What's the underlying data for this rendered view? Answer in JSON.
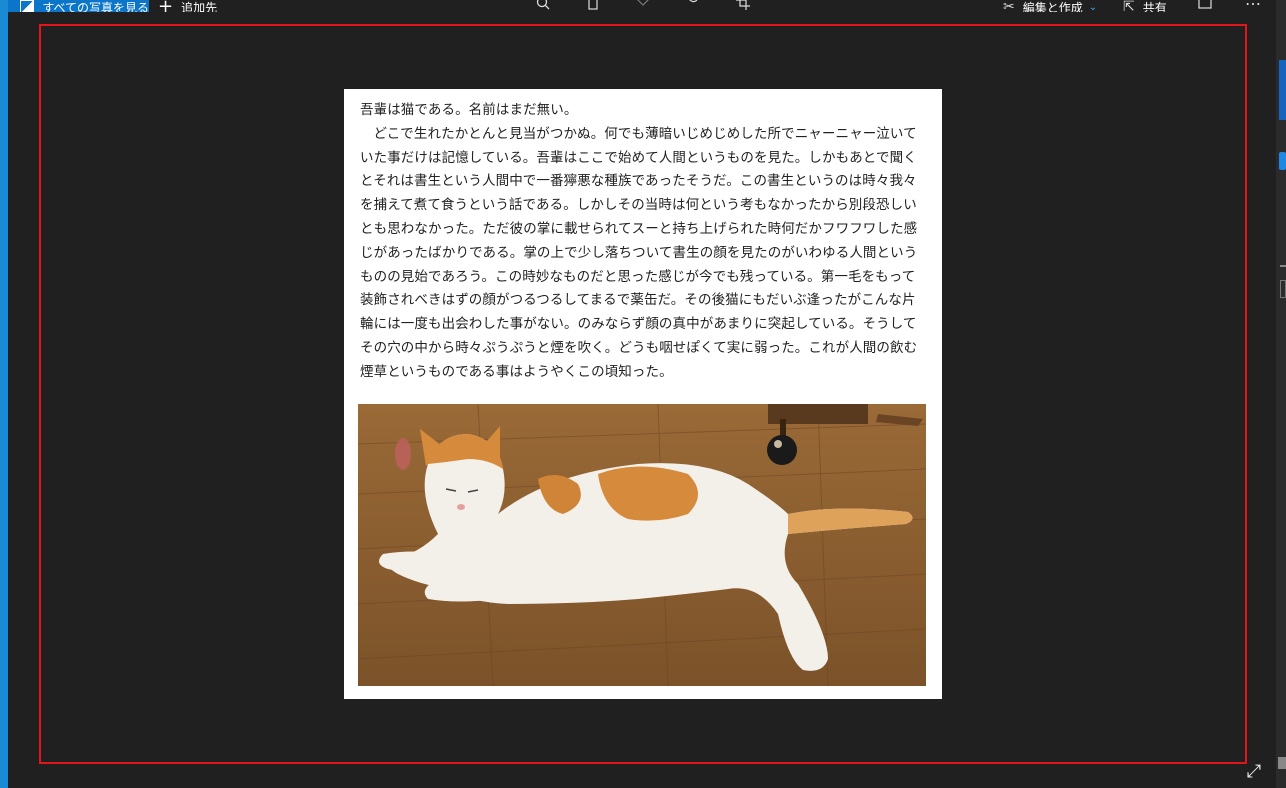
{
  "app": {
    "toolbar": {
      "see_all_label": "すべての写真を見る",
      "add_to_label": "追加先",
      "edit_create_label": "編集と作成",
      "share_label": "共有",
      "more_label": "…"
    }
  },
  "document": {
    "title_line": "吾輩は猫である。名前はまだ無い。",
    "body": "どこで生れたかとんと見当がつかぬ。何でも薄暗いじめじめした所でニャーニャー泣いていた事だけは記憶している。吾輩はここで始めて人間というものを見た。しかもあとで聞くとそれは書生という人間中で一番獰悪な種族であったそうだ。この書生というのは時々我々を捕えて煮て食うという話である。しかしその当時は何という考もなかったから別段恐しいとも思わなかった。ただ彼の掌に載せられてスーと持ち上げられた時何だかフワフワした感じがあったばかりである。掌の上で少し落ちついて書生の顔を見たのがいわゆる人間というものの見始であろう。この時妙なものだと思った感じが今でも残っている。第一毛をもって装飾されべきはずの顔がつるつるしてまるで薬缶だ。その後猫にもだいぶ逢ったがこんな片輪には一度も出会わした事がない。のみならず顔の真中があまりに突起している。そうしてその穴の中から時々ぷうぷうと煙を吹く。どうも咽せぽくて実に弱った。これが人間の飲む煙草というものである事はようやくこの頃知った。"
  },
  "colors": {
    "background": "#202020",
    "accent": "#0b75c9",
    "selection": "#e0161c"
  }
}
